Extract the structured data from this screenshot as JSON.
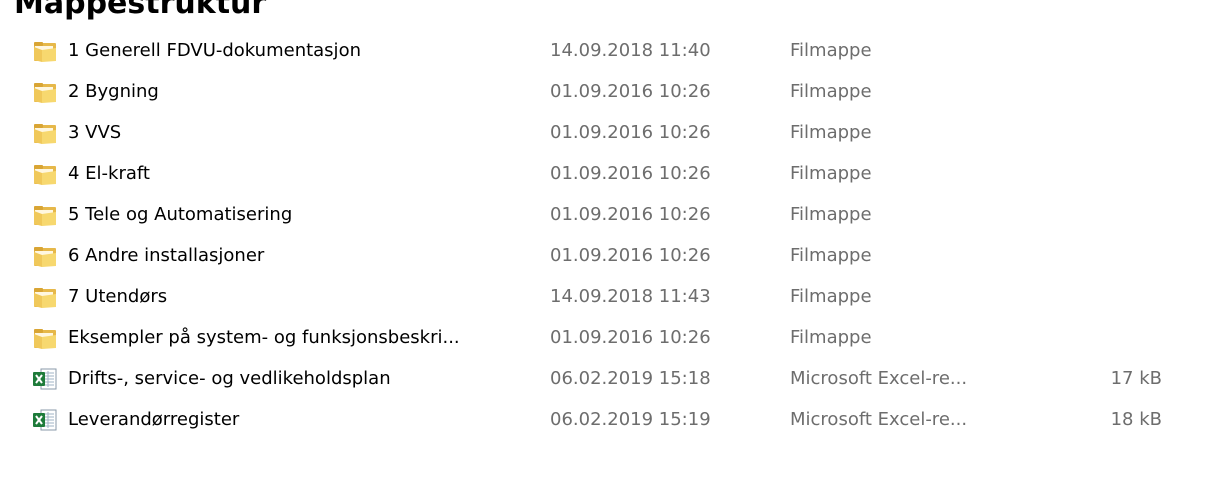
{
  "heading": "Mappestruktur",
  "files": [
    {
      "name": "1 Generell FDVU-dokumentasjon",
      "date": "14.09.2018 11:40",
      "type": "Filmappe",
      "size": "",
      "icon": "folder-icon"
    },
    {
      "name": "2 Bygning",
      "date": "01.09.2016 10:26",
      "type": "Filmappe",
      "size": "",
      "icon": "folder-icon"
    },
    {
      "name": "3 VVS",
      "date": "01.09.2016 10:26",
      "type": "Filmappe",
      "size": "",
      "icon": "folder-icon"
    },
    {
      "name": "4 El-kraft",
      "date": "01.09.2016 10:26",
      "type": "Filmappe",
      "size": "",
      "icon": "folder-icon"
    },
    {
      "name": "5 Tele og Automatisering",
      "date": "01.09.2016 10:26",
      "type": "Filmappe",
      "size": "",
      "icon": "folder-icon"
    },
    {
      "name": "6 Andre installasjoner",
      "date": "01.09.2016 10:26",
      "type": "Filmappe",
      "size": "",
      "icon": "folder-icon"
    },
    {
      "name": "7 Utendørs",
      "date": "14.09.2018 11:43",
      "type": "Filmappe",
      "size": "",
      "icon": "folder-icon"
    },
    {
      "name": "Eksempler på system- og funksjonsbeskri...",
      "date": "01.09.2016 10:26",
      "type": "Filmappe",
      "size": "",
      "icon": "folder-icon"
    },
    {
      "name": "Drifts-, service- og vedlikeholdsplan",
      "date": "06.02.2019 15:18",
      "type": "Microsoft Excel-re...",
      "size": "17 kB",
      "icon": "excel-file-icon"
    },
    {
      "name": "Leverandørregister",
      "date": "06.02.2019 15:19",
      "type": "Microsoft Excel-re...",
      "size": "18 kB",
      "icon": "excel-file-icon"
    }
  ]
}
